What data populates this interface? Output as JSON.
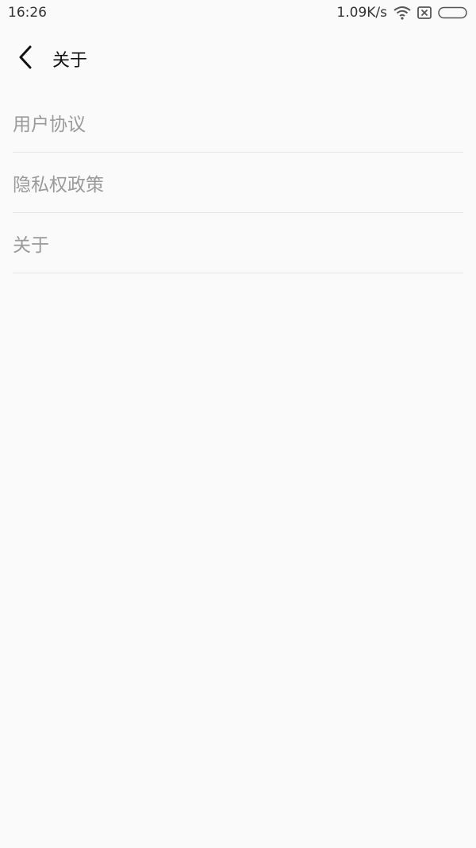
{
  "status_bar": {
    "time": "16:26",
    "network_speed": "1.09K/s",
    "icons": [
      "wifi-icon",
      "sim-x-icon",
      "battery-icon"
    ]
  },
  "header": {
    "back_icon": "chevron-left-icon",
    "title": "关于"
  },
  "menu": {
    "items": [
      {
        "label": "用户协议"
      },
      {
        "label": "隐私权政策"
      },
      {
        "label": "关于"
      }
    ]
  },
  "colors": {
    "background": "#fafafa",
    "item_text": "#9a9a9a",
    "title_text": "#111111",
    "divider": "#e6e6e6"
  }
}
